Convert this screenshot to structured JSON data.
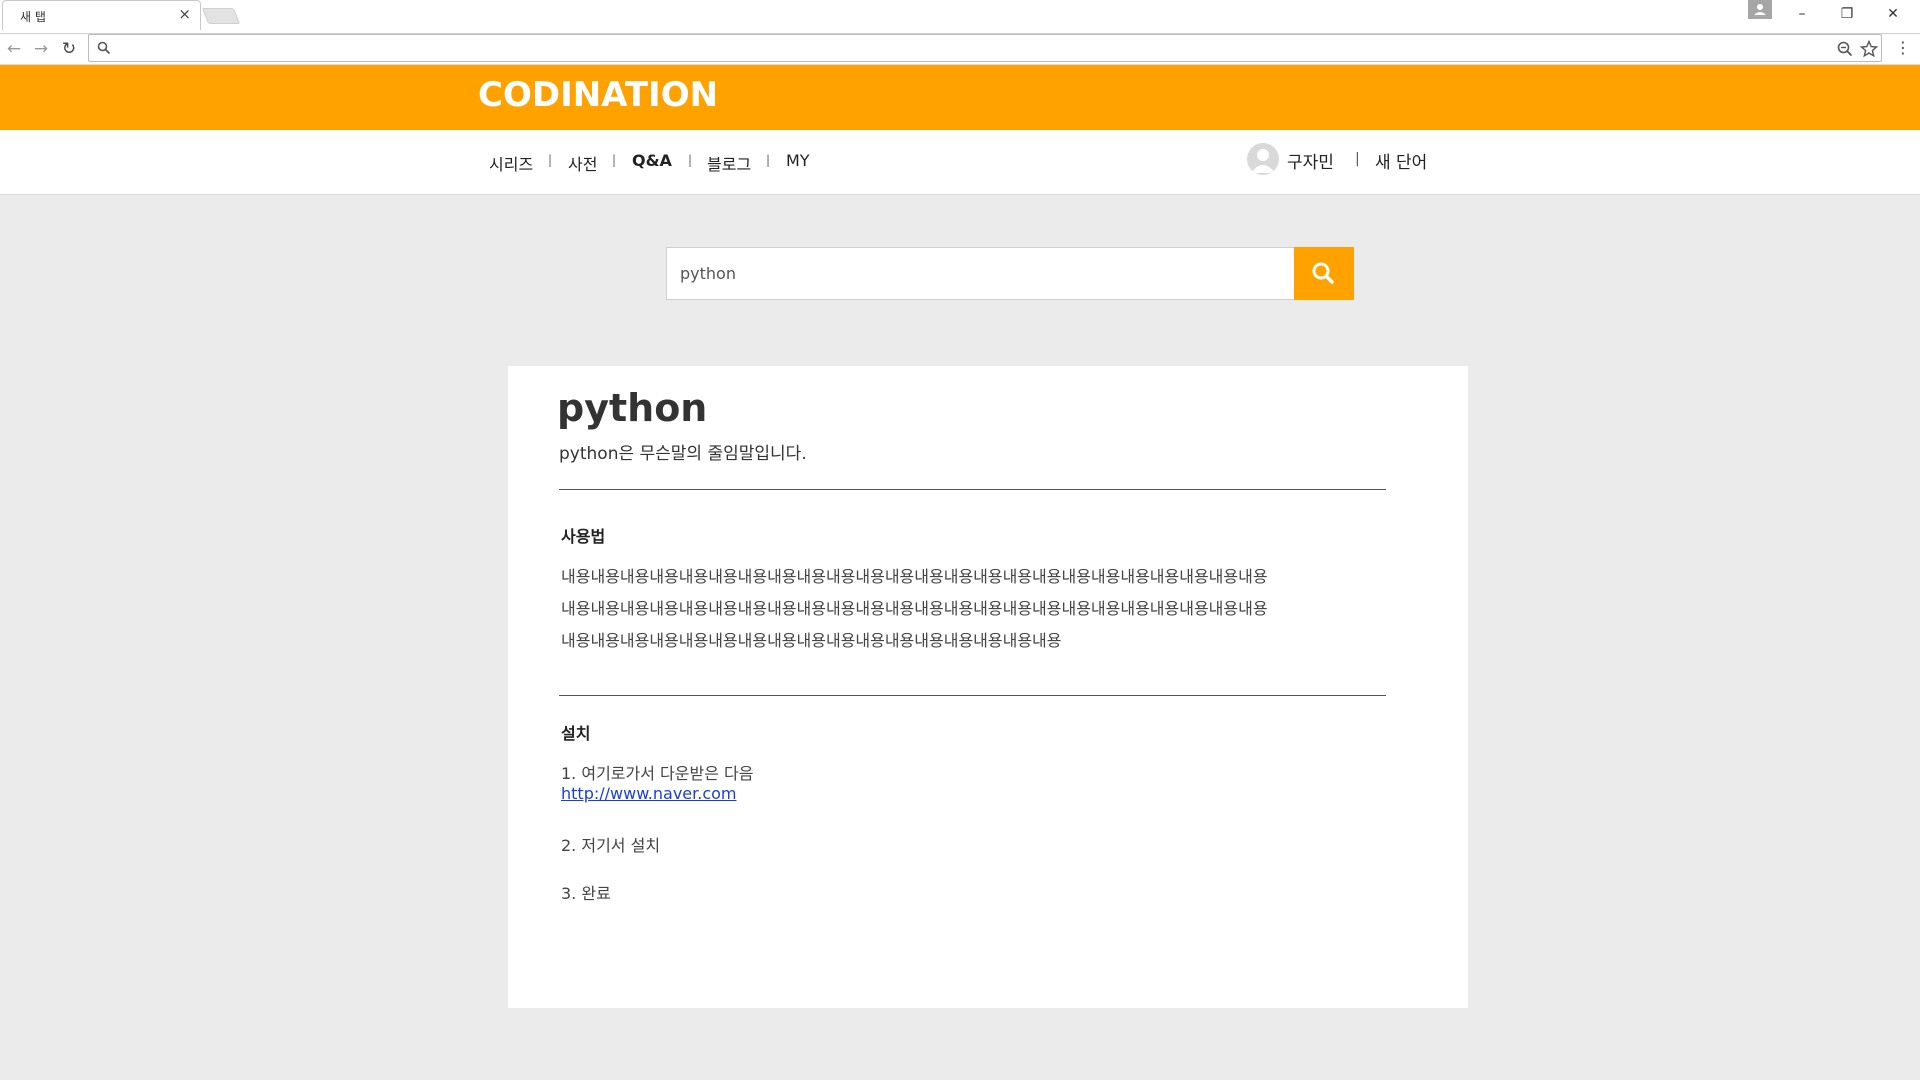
{
  "browser": {
    "tab_title": "새 탭",
    "tab_close": "×",
    "address_value": "",
    "nav": {
      "back": "←",
      "forward": "→",
      "reload": "↻"
    },
    "win_controls": {
      "minimize": "–",
      "restore": "❐",
      "close": "✕"
    },
    "menu": "⋮",
    "icons": {
      "zoom": "zoom-icon",
      "star": "star-icon"
    }
  },
  "site": {
    "logo": "CODINATION",
    "brand_color": "#ffa200",
    "nav_items": [
      "시리즈",
      "사전",
      "Q&A",
      "블로그",
      "MY"
    ],
    "nav_sep": "|",
    "user": {
      "name": "구자민",
      "sep": "|",
      "new_word": "새 단어"
    }
  },
  "search": {
    "value": "python"
  },
  "entry": {
    "title": "python",
    "description": "python은 무슨말의 줄임말입니다.",
    "usage": {
      "heading": "사용법",
      "lines": [
        "내용내용내용내용내용내용내용내용내용내용내용내용내용내용내용내용내용내용내용내용내용내용내용내용",
        "내용내용내용내용내용내용내용내용내용내용내용내용내용내용내용내용내용내용내용내용내용내용내용내용",
        "내용내용내용내용내용내용내용내용내용내용내용내용내용내용내용내용내용"
      ]
    },
    "install": {
      "heading": "설치",
      "step1": "1. 여기로가서 다운받은 다음",
      "link": "http://www.naver.com",
      "step2": "2. 저기서 설치",
      "step3": "3. 완료"
    }
  }
}
